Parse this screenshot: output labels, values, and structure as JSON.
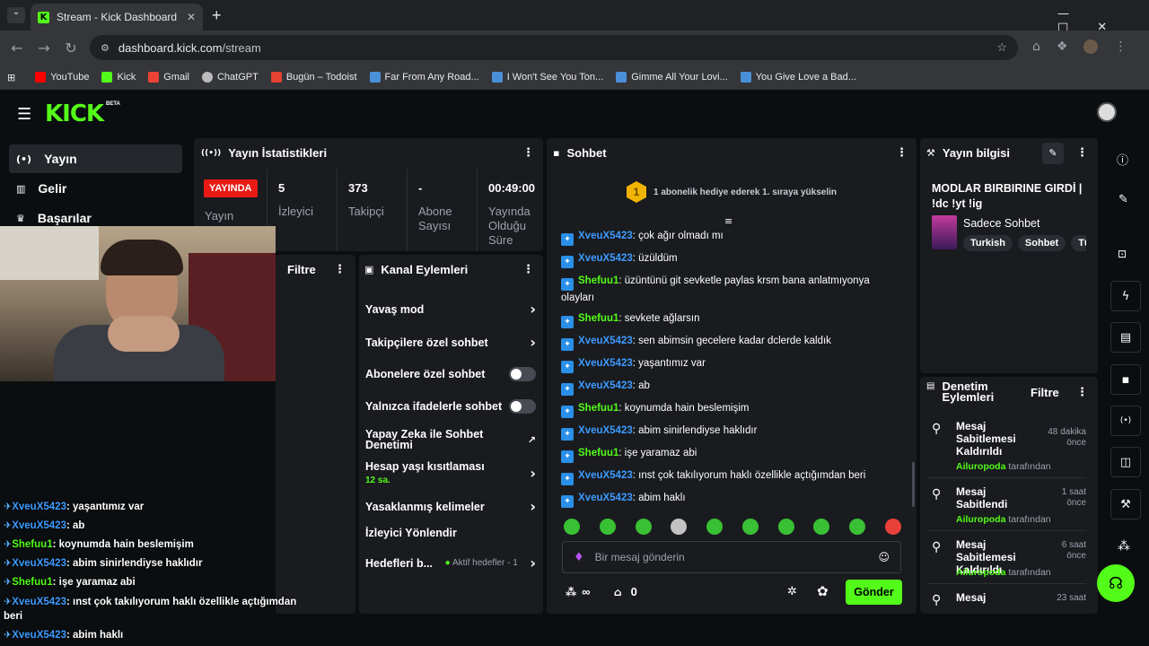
{
  "browser": {
    "tab_title": "Stream - Kick Dashboard",
    "tab_close": "✕",
    "new_tab": "+",
    "url_host": "dashboard.kick.com",
    "url_path": "/stream",
    "bookmarks": [
      {
        "label": "YouTube",
        "color": "#ff0000"
      },
      {
        "label": "Kick",
        "color": "#53fc18"
      },
      {
        "label": "Gmail",
        "color": "#ea4335"
      },
      {
        "label": "ChatGPT",
        "color": "#bbbbbb"
      },
      {
        "label": "Bugün – Todoist",
        "color": "#e44232"
      },
      {
        "label": "Far From Any Road...",
        "color": "#4a90d9"
      },
      {
        "label": "I Won't See You Ton...",
        "color": "#4a90d9"
      },
      {
        "label": "Gimme All Your Lovi...",
        "color": "#4a90d9"
      },
      {
        "label": "You Give Love a Bad...",
        "color": "#4a90d9"
      }
    ]
  },
  "kick": {
    "logo": "KICK",
    "beta": "BETA"
  },
  "sidebar": {
    "items": [
      {
        "label": "Yayın",
        "icon": "stream-icon"
      },
      {
        "label": "Gelir",
        "icon": "chart-icon"
      },
      {
        "label": "Başarılar",
        "icon": "trophy-icon"
      }
    ]
  },
  "stats": {
    "title": "Yayın İstatistikleri",
    "live_badge": "YAYINDA",
    "live_label": "Yayın",
    "viewers_value": "5",
    "viewers_label": "İzleyici",
    "followers_value": "373",
    "followers_label": "Takipçi",
    "subs_value": "-",
    "subs_label": "Abone Sayısı",
    "duration_value": "00:49:00",
    "duration_label": "Yayında Olduğu Süre"
  },
  "filter_panel": {
    "title": "Filtre"
  },
  "channel_actions": {
    "title": "Kanal Eylemleri",
    "slow_mode": "Yavaş mod",
    "followers_only": "Takipçilere özel sohbet",
    "subs_only": "Abonelere özel sohbet",
    "emote_only": "Yalnızca ifadelerle sohbet",
    "ai_moderation": "Yapay Zeka ile Sohbet Denetimi",
    "account_age": "Hesap yaşı kısıtlaması",
    "account_age_value": "12 sa.",
    "banned_words": "Yasaklanmış kelimeler",
    "host": "İzleyici Yönlendir",
    "goals": "Hedefleri b...",
    "goals_status": "Aktif hedefler - 1"
  },
  "chat": {
    "title": "Sohbet",
    "banner_num": "1",
    "banner": "1 abonelik hediye ederek 1. sıraya yükselin",
    "messages": [
      {
        "user": "XveuX5423",
        "text": ": çok ağır olmadı mı",
        "color": "blue"
      },
      {
        "user": "XveuX5423",
        "text": ": üzüldüm",
        "color": "blue"
      },
      {
        "user": "Shefuu1",
        "text": ": üzüntünü git sevketle paylas krsm bana anlatmıyonya olayları",
        "color": "green"
      },
      {
        "user": "Shefuu1",
        "text": ": sevkete ağlarsın",
        "color": "green"
      },
      {
        "user": "XveuX5423",
        "text": ": sen abimsin gecelere kadar dclerde kaldık",
        "color": "blue"
      },
      {
        "user": "XveuX5423",
        "text": ": yaşantımız var",
        "color": "blue"
      },
      {
        "user": "XveuX5423",
        "text": ": ab",
        "color": "blue"
      },
      {
        "user": "Shefuu1",
        "text": ": koynumda hain beslemişim",
        "color": "green"
      },
      {
        "user": "XveuX5423",
        "text": ": abim sinirlendiyse haklıdır",
        "color": "blue"
      },
      {
        "user": "Shefuu1",
        "text": ": işe yaramaz abi",
        "color": "green"
      },
      {
        "user": "XveuX5423",
        "text": ": ınst çok takılıyorum haklı özellikle açtığımdan beri",
        "color": "blue"
      },
      {
        "user": "XveuX5423",
        "text": ": abim haklı",
        "color": "blue"
      }
    ],
    "input_placeholder": "Bir mesaj gönderin",
    "points": "∞",
    "chest": "0",
    "send": "Gönder"
  },
  "stream_info": {
    "title": "Yayın bilgisi",
    "stream_title": "MODLAR BIRBIRINE GIRDİ | !dc !yt !ig",
    "category": "Sadece Sohbet",
    "tags": [
      "Turkish",
      "Sohbet",
      "Türk"
    ]
  },
  "moderation": {
    "title": "Denetim Eylemleri",
    "filter": "Filtre",
    "items": [
      {
        "action": "Mesaj Sabitlemesi Kaldırıldı",
        "by": "Ailuropoda",
        "by_suffix": "tarafından",
        "time": "48 dakika önce",
        "icon": "unpin-icon"
      },
      {
        "action": "Mesaj Sabitlendi",
        "by": "Ailuropoda",
        "by_suffix": "tarafından",
        "time": "1 saat önce",
        "icon": "pin-icon"
      },
      {
        "action": "Mesaj Sabitlemesi Kaldırıldı",
        "by": "Ailuropoda",
        "by_suffix": "tarafından",
        "time": "6 saat önce",
        "icon": "unpin-icon"
      },
      {
        "action": "Mesaj",
        "by": "",
        "by_suffix": "",
        "time": "23 saat",
        "icon": "pin-icon"
      }
    ]
  },
  "overlay_chat": [
    {
      "user": "XveuX5423",
      "text": "yaşantımız var",
      "color": "blue"
    },
    {
      "user": "XveuX5423",
      "text": "ab",
      "color": "blue"
    },
    {
      "user": "Shefuu1",
      "text": "koynumda hain beslemişim",
      "color": "green"
    },
    {
      "user": "XveuX5423",
      "text": "abim sinirlendiyse haklıdır",
      "color": "blue"
    },
    {
      "user": "Shefuu1",
      "text": "işe yaramaz abi",
      "color": "green"
    },
    {
      "user": "XveuX5423",
      "text": "ınst çok takılıyorum haklı özellikle açtığımdan beri",
      "color": "blue"
    },
    {
      "user": "XveuX5423",
      "text": "abim haklı",
      "color": "blue"
    }
  ],
  "colors": {
    "brand": "#53fc18",
    "live": "#e91916",
    "user_blue": "#3d9bff",
    "user_green": "#53fc18"
  }
}
